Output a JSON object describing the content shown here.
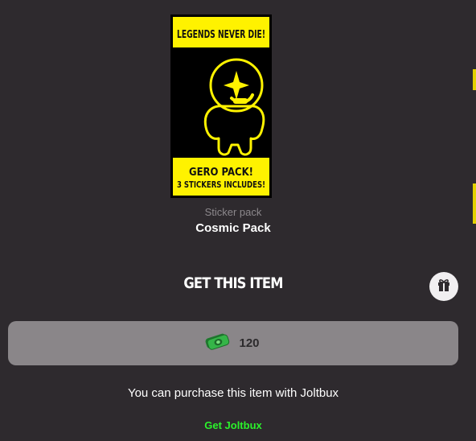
{
  "item": {
    "art": {
      "top_banner": "LEGENDS NEVER DIE!",
      "bottom_line1": "GERO PACK!",
      "bottom_line2": "3 STICKERS INCLUDES!"
    },
    "type_label": "Sticker pack",
    "name": "Cosmic Pack"
  },
  "purchase": {
    "title": "GET THIS ITEM",
    "price": "120",
    "currency_icon": "joltbux-coin-icon",
    "note": "You can purchase this item with Joltbux",
    "get_currency_link": "Get Joltbux"
  },
  "icons": {
    "gift": "gift-icon"
  },
  "colors": {
    "background": "#2e2a2e",
    "pack_yellow": "#fff200",
    "pack_black": "#000000",
    "price_button": "#8a8689",
    "link_green": "#2bf22b",
    "gift_button": "#f1eff1"
  }
}
